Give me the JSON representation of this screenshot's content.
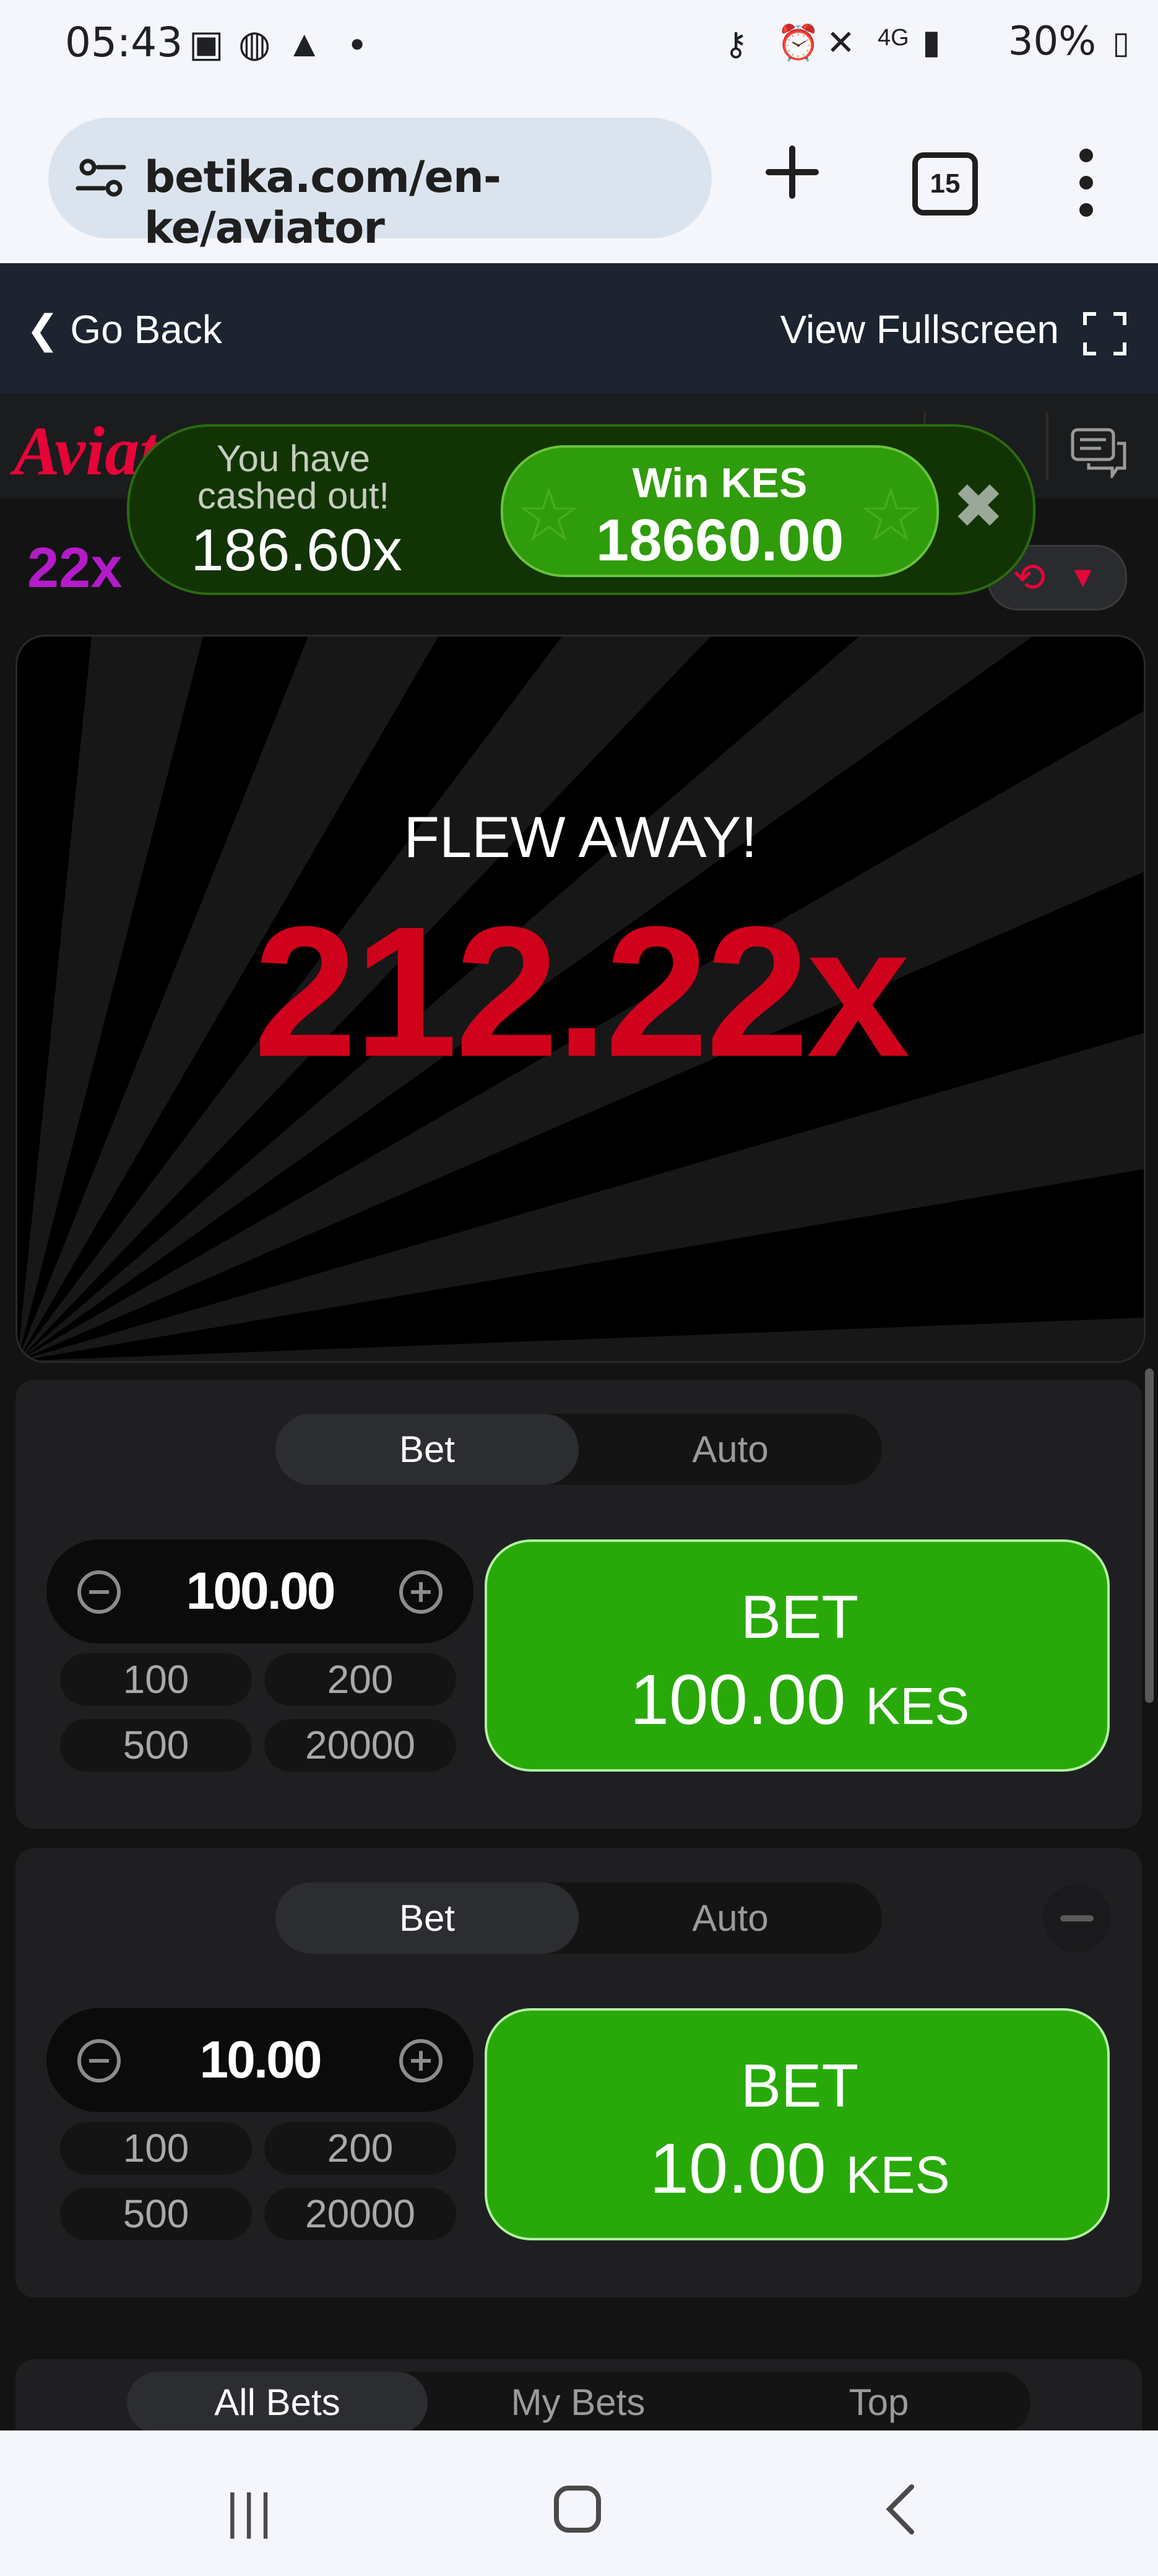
{
  "status_bar": {
    "time": "05:43",
    "battery": "30%"
  },
  "browser": {
    "url": "betika.com/en-ke/aviator",
    "tab_count": "15"
  },
  "game_header": {
    "back_label": "Go Back",
    "fullscreen_label": "View Fullscreen"
  },
  "topbar": {
    "logo": "Aviator",
    "latest_multiplier": "22x"
  },
  "toast": {
    "message": "You have cashed out!",
    "multiplier": "186.60x",
    "win_label": "Win KES",
    "win_amount": "18660.00"
  },
  "game": {
    "status": "FLEW AWAY!",
    "multiplier": "212.22x"
  },
  "bet_panels": [
    {
      "tab_bet": "Bet",
      "tab_auto": "Auto",
      "amount": "100.00",
      "chips": [
        "100",
        "200",
        "500",
        "20000"
      ],
      "button_label": "BET",
      "button_amount": "100.00",
      "currency": "KES"
    },
    {
      "tab_bet": "Bet",
      "tab_auto": "Auto",
      "amount": "10.00",
      "chips": [
        "100",
        "200",
        "500",
        "20000"
      ],
      "button_label": "BET",
      "button_amount": "10.00",
      "currency": "KES"
    }
  ],
  "bets_tabs": [
    "All Bets",
    "My Bets",
    "Top"
  ],
  "colors": {
    "accent_red": "#d0021b",
    "bet_green": "#28a909",
    "multiplier_purple": "#b31cc8"
  }
}
